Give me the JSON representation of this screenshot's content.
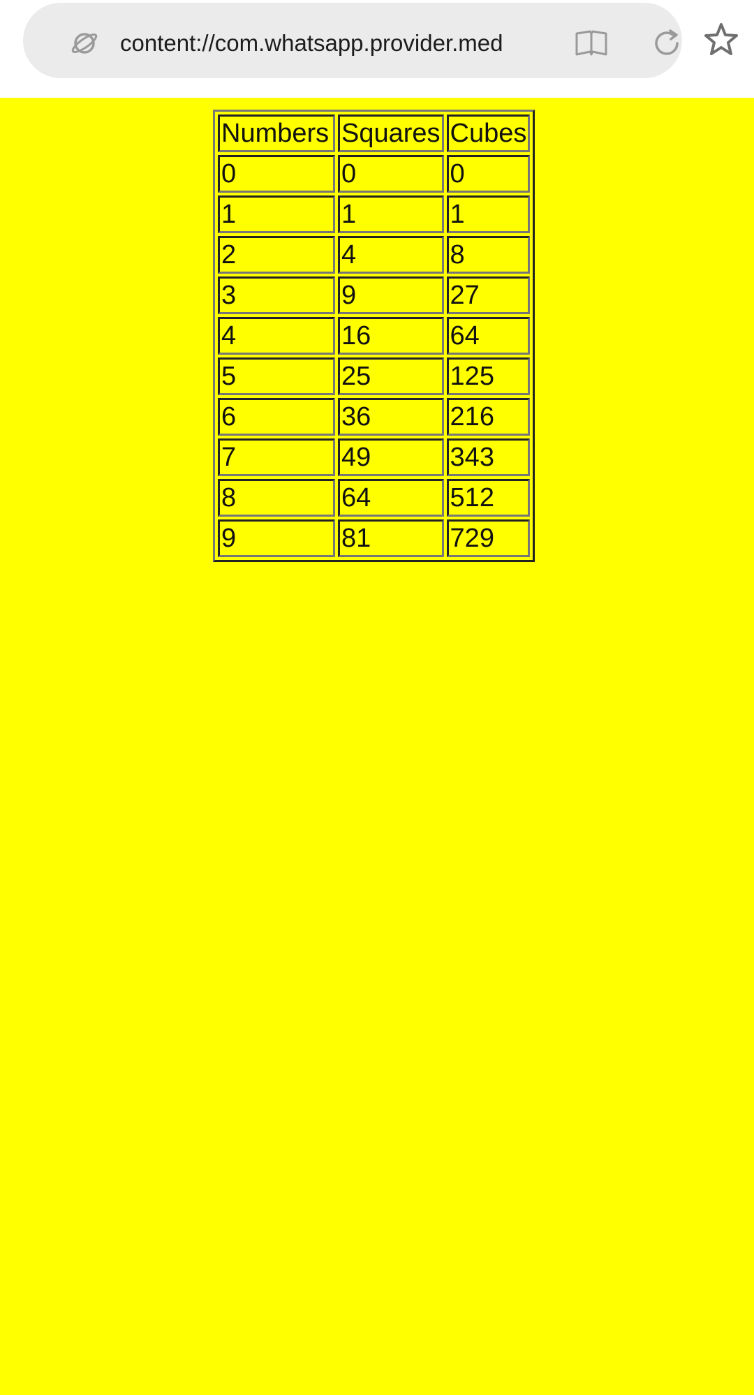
{
  "browser": {
    "url": "content://com.whatsapp.provider.med",
    "icons": {
      "site": "site-info-icon",
      "reader": "reader-mode-icon",
      "reload": "reload-icon",
      "bookmark": "star-icon"
    }
  },
  "page": {
    "background_color": "#ffff00",
    "table": {
      "headers": [
        "Numbers",
        "Squares",
        "Cubes"
      ],
      "rows": [
        [
          "0",
          "0",
          "0"
        ],
        [
          "1",
          "1",
          "1"
        ],
        [
          "2",
          "4",
          "8"
        ],
        [
          "3",
          "9",
          "27"
        ],
        [
          "4",
          "16",
          "64"
        ],
        [
          "5",
          "25",
          "125"
        ],
        [
          "6",
          "36",
          "216"
        ],
        [
          "7",
          "49",
          "343"
        ],
        [
          "8",
          "64",
          "512"
        ],
        [
          "9",
          "81",
          "729"
        ]
      ]
    }
  }
}
